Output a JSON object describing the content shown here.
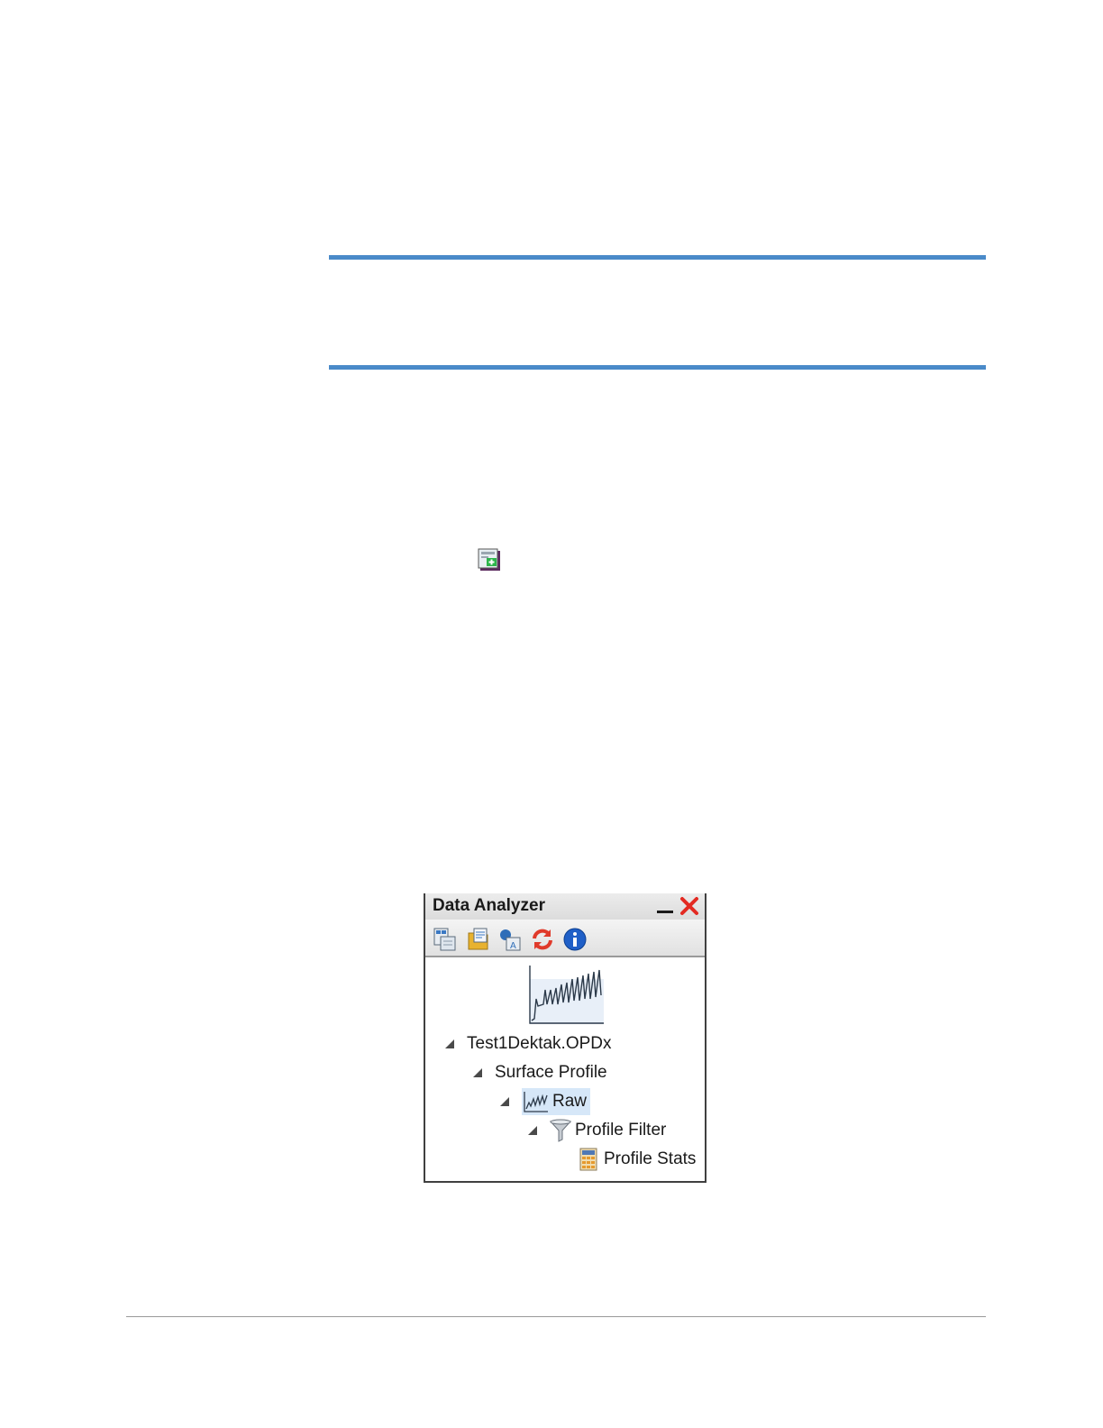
{
  "panel": {
    "title": "Data Analyzer",
    "controls": {
      "minimize": "minimize-icon",
      "close": "close-icon",
      "close_color": "#e32a22"
    },
    "toolbar": [
      "add-data-icon",
      "open-folder-icon",
      "export-icon",
      "refresh-icon",
      "info-icon"
    ],
    "tree": {
      "file": "Test1Dektak.OPDx",
      "profile": "Surface Profile",
      "raw": "Raw",
      "filter": "Profile Filter",
      "stats": "Profile Stats"
    }
  },
  "colors": {
    "accent_rule": "#4a8ac9",
    "selection": "#d6e7f8"
  }
}
